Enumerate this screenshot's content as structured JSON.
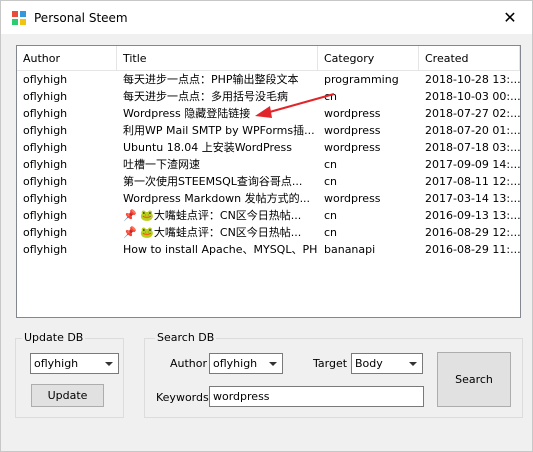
{
  "window": {
    "title": "Personal Steem",
    "close_glyph": "✕",
    "app_icon": "colorful-app-icon"
  },
  "table": {
    "columns": [
      "Author",
      "Title",
      "Category",
      "Created"
    ],
    "rows": [
      {
        "author": "oflyhigh",
        "title": "每天进步一点点：PHP输出整段文本",
        "category": "programming",
        "created": "2018-10-28 13:..."
      },
      {
        "author": "oflyhigh",
        "title": "每天进步一点点：多用括号没毛病",
        "category": "cn",
        "created": "2018-10-03 00:..."
      },
      {
        "author": "oflyhigh",
        "title": "Wordpress 隐藏登陆链接",
        "category": "wordpress",
        "created": "2018-07-27 02:..."
      },
      {
        "author": "oflyhigh",
        "title": "利用WP Mail SMTP by WPForms插...",
        "category": "wordpress",
        "created": "2018-07-20 01:..."
      },
      {
        "author": "oflyhigh",
        "title": "Ubuntu 18.04 上安装WordPress",
        "category": "wordpress",
        "created": "2018-07-18 03:..."
      },
      {
        "author": "oflyhigh",
        "title": "吐槽一下渣网速",
        "category": "cn",
        "created": "2017-09-09 14:..."
      },
      {
        "author": "oflyhigh",
        "title": "第一次使用STEEMSQL查询谷哥点...",
        "category": "cn",
        "created": "2017-08-11 12:..."
      },
      {
        "author": "oflyhigh",
        "title": "Wordpress Markdown 发帖方式的...",
        "category": "wordpress",
        "created": "2017-03-14 13:..."
      },
      {
        "author": "oflyhigh",
        "title": "📌 🐸大嘴蛙点评：CN区今日热帖...",
        "category": "cn",
        "created": "2016-09-13 13:..."
      },
      {
        "author": "oflyhigh",
        "title": "📌 🐸大嘴蛙点评：CN区今日热帖...",
        "category": "cn",
        "created": "2016-08-29 12:..."
      },
      {
        "author": "oflyhigh",
        "title": "How  to install Apache、MYSQL、PH...",
        "category": "bananapi",
        "created": "2016-08-29 11:..."
      }
    ]
  },
  "update_db": {
    "group_label": "Update DB",
    "author_value": "oflyhigh",
    "button_label": "Update"
  },
  "search_db": {
    "group_label": "Search DB",
    "author_label": "Author",
    "author_value": "oflyhigh",
    "target_label": "Target",
    "target_value": "Body",
    "keywords_label": "Keywords",
    "keywords_value": "wordpress",
    "search_button": "Search"
  },
  "colors": {
    "annotation_arrow": "#e0262b",
    "window_bg": "#f0f0f0"
  }
}
